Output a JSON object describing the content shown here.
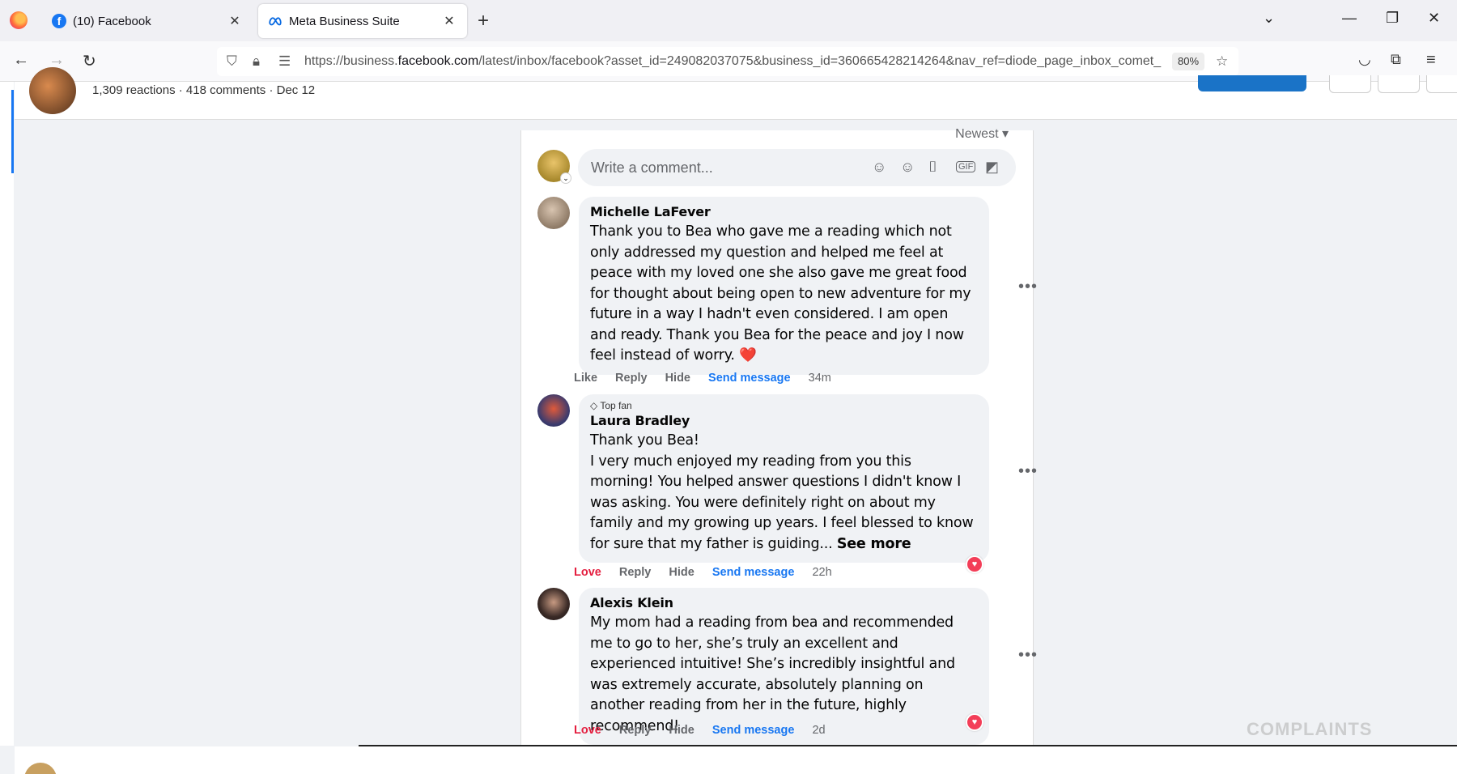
{
  "browser": {
    "tabs": [
      {
        "label": "(10) Facebook",
        "icon": "facebook-icon"
      },
      {
        "label": "Meta Business Suite",
        "icon": "meta-icon"
      }
    ],
    "url": {
      "prefix": "https://business.",
      "domain": "facebook.com",
      "suffix": "/latest/inbox/facebook?asset_id=249082037075&business_id=360665428214264&nav_ref=diode_page_inbox_comet_"
    },
    "zoom": "80%"
  },
  "post": {
    "meta": "1,309 reactions · 418 comments · Dec 12"
  },
  "comments_panel": {
    "sort_label": "Newest",
    "composer_placeholder": "Write a comment...",
    "comments": [
      {
        "author": "Michelle LaFever",
        "text": "Thank you to Bea who gave me a reading which not only addressed my question and helped me feel at peace with my loved one she also gave me great food for thought about being open to new adventure for my future in a way I hadn't even considered. I am open and ready. Thank you Bea for the peace and joy I now feel instead of worry.",
        "emoji": "❤️",
        "actions": {
          "like": "Like",
          "reply": "Reply",
          "hide": "Hide",
          "send": "Send message",
          "time": "34m"
        }
      },
      {
        "badge": "Top fan",
        "author": "Laura Bradley",
        "text_line1": "Thank you Bea!",
        "text": "I very much enjoyed my reading from you this morning! You helped answer questions I didn't know I was asking. You were definitely right on about my family and my growing up years. I feel blessed to know for sure that my father is guiding...",
        "see_more": "See more",
        "actions": {
          "like": "Love",
          "reply": "Reply",
          "hide": "Hide",
          "send": "Send message",
          "time": "22h"
        }
      },
      {
        "author": "Alexis Klein",
        "text": "My mom had a reading from bea and recommended me to go to her, she’s truly an excellent and experienced intuitive! She’s incredibly insightful and was extremely accurate, absolutely planning on another reading from her in the future, highly recommend!",
        "actions": {
          "like": "Love",
          "reply": "Reply",
          "hide": "Hide",
          "send": "Send message",
          "time": "2d"
        }
      }
    ]
  },
  "watermark": "COMPLAINTS",
  "colors": {
    "accent": "#1877f2",
    "love": "#e41e3f",
    "bubble": "#f0f2f5"
  }
}
